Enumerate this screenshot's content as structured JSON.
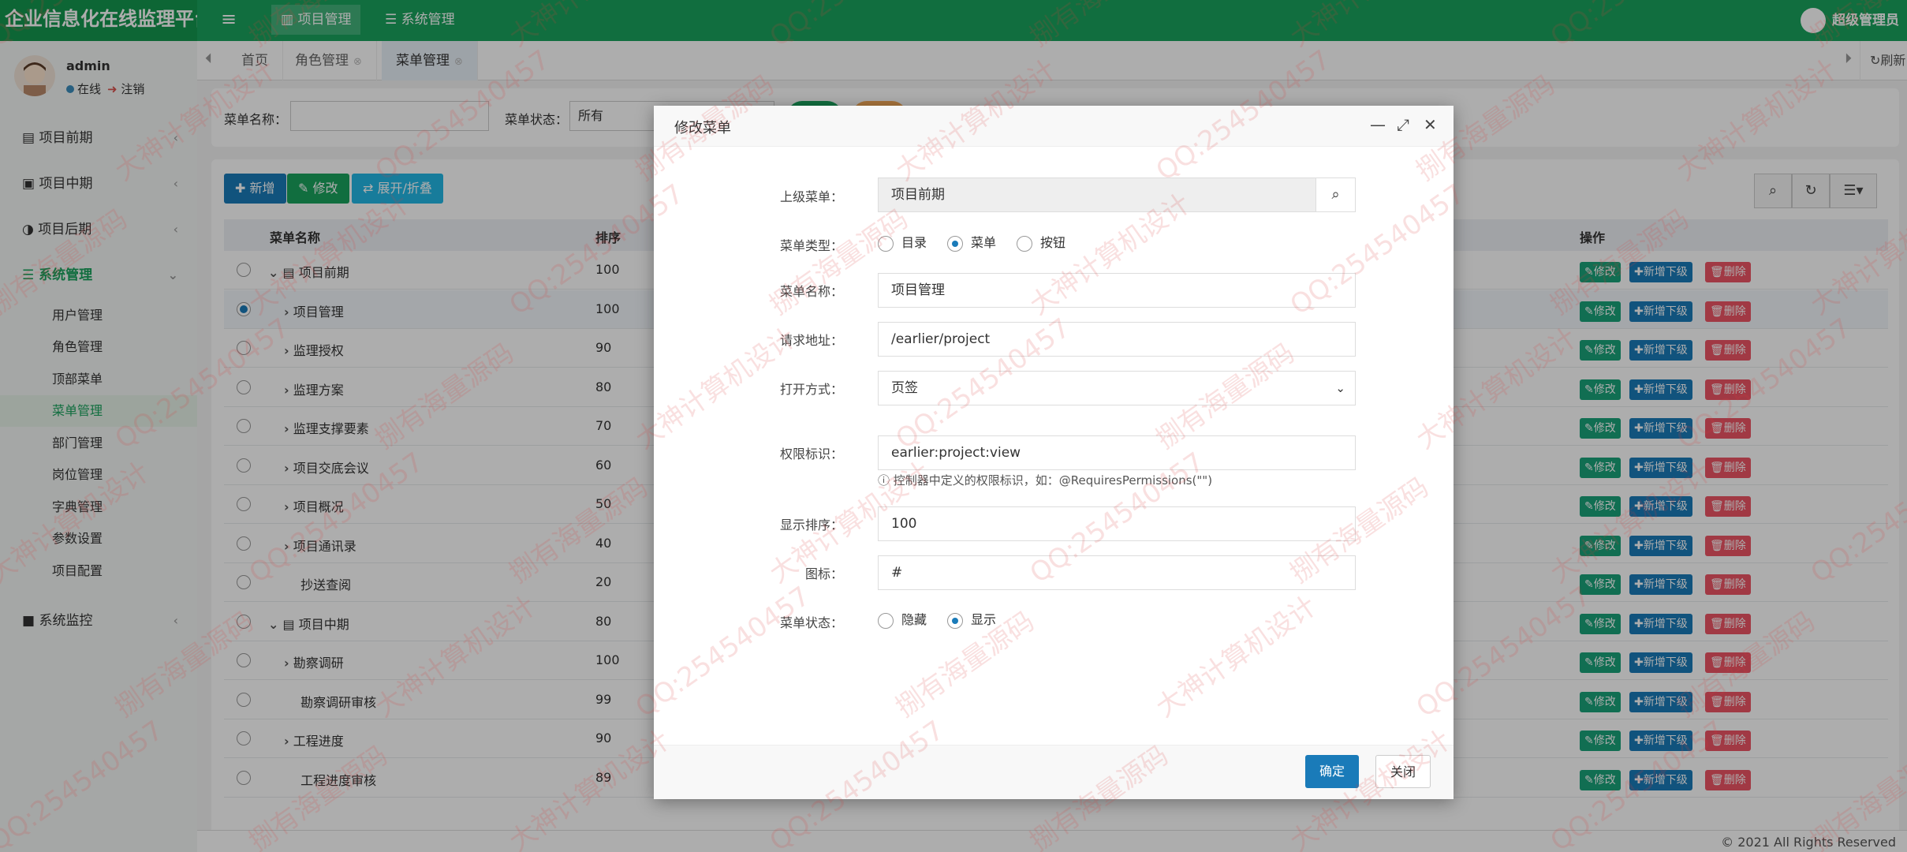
{
  "app": {
    "title": "企业信息化在线监理平台"
  },
  "topnav": {
    "project": "项目管理",
    "system": "系统管理",
    "user": "超级管理员"
  },
  "sidebar": {
    "username": "admin",
    "status": "在线",
    "logout": "注销",
    "menu": [
      "项目前期",
      "项目中期",
      "项目后期",
      "系统管理",
      "系统监控"
    ],
    "submenu": [
      "用户管理",
      "角色管理",
      "顶部菜单",
      "菜单管理",
      "部门管理",
      "岗位管理",
      "字典管理",
      "参数设置",
      "项目配置"
    ]
  },
  "tabs": {
    "items": [
      "首页",
      "角色管理",
      "菜单管理"
    ],
    "refresh": "刷新"
  },
  "search": {
    "name_label": "菜单名称：",
    "status_label": "菜单状态：",
    "status_value": "所有"
  },
  "toolbar": {
    "add": "新增",
    "edit": "修改",
    "expand": "展开/折叠"
  },
  "table": {
    "headers": {
      "name": "菜单名称",
      "order": "排序",
      "ops": "操作"
    },
    "rows": [
      {
        "name": "项目前期",
        "order": "100"
      },
      {
        "name": "项目管理",
        "order": "100"
      },
      {
        "name": "监理授权",
        "order": "90"
      },
      {
        "name": "监理方案",
        "order": "80"
      },
      {
        "name": "监理支撑要素",
        "order": "70"
      },
      {
        "name": "项目交底会议",
        "order": "60"
      },
      {
        "name": "项目概况",
        "order": "50"
      },
      {
        "name": "项目通讯录",
        "order": "40"
      },
      {
        "name": "抄送查阅",
        "order": "20"
      },
      {
        "name": "项目中期",
        "order": "80"
      },
      {
        "name": "勘察调研",
        "order": "100"
      },
      {
        "name": "勘察调研审核",
        "order": "99"
      },
      {
        "name": "工程进度",
        "order": "90"
      },
      {
        "name": "工程进度审核",
        "order": "89"
      }
    ],
    "op_edit": "修改",
    "op_add": "新增下级",
    "op_del": "删除"
  },
  "footer": {
    "copyright": "© 2021 All Rights Reserved"
  },
  "modal": {
    "title": "修改菜单",
    "parent_label": "上级菜单：",
    "parent_value": "项目前期",
    "type_label": "菜单类型：",
    "type_options": [
      "目录",
      "菜单",
      "按钮"
    ],
    "name_label": "菜单名称：",
    "name_value": "项目管理",
    "url_label": "请求地址：",
    "url_value": "/earlier/project",
    "target_label": "打开方式：",
    "target_value": "页签",
    "perms_label": "权限标识：",
    "perms_value": "earlier:project:view",
    "perms_hint": "控制器中定义的权限标识，如：@RequiresPermissions(\"\")",
    "order_label": "显示排序：",
    "order_value": "100",
    "icon_label": "图标：",
    "icon_value": "#",
    "visible_label": "菜单状态：",
    "visible_options": [
      "隐藏",
      "显示"
    ],
    "ok": "确定",
    "close": "关闭"
  },
  "colors": {
    "brand": "#1aa35e",
    "primary": "#1a7bb9",
    "danger": "#ed5565"
  }
}
